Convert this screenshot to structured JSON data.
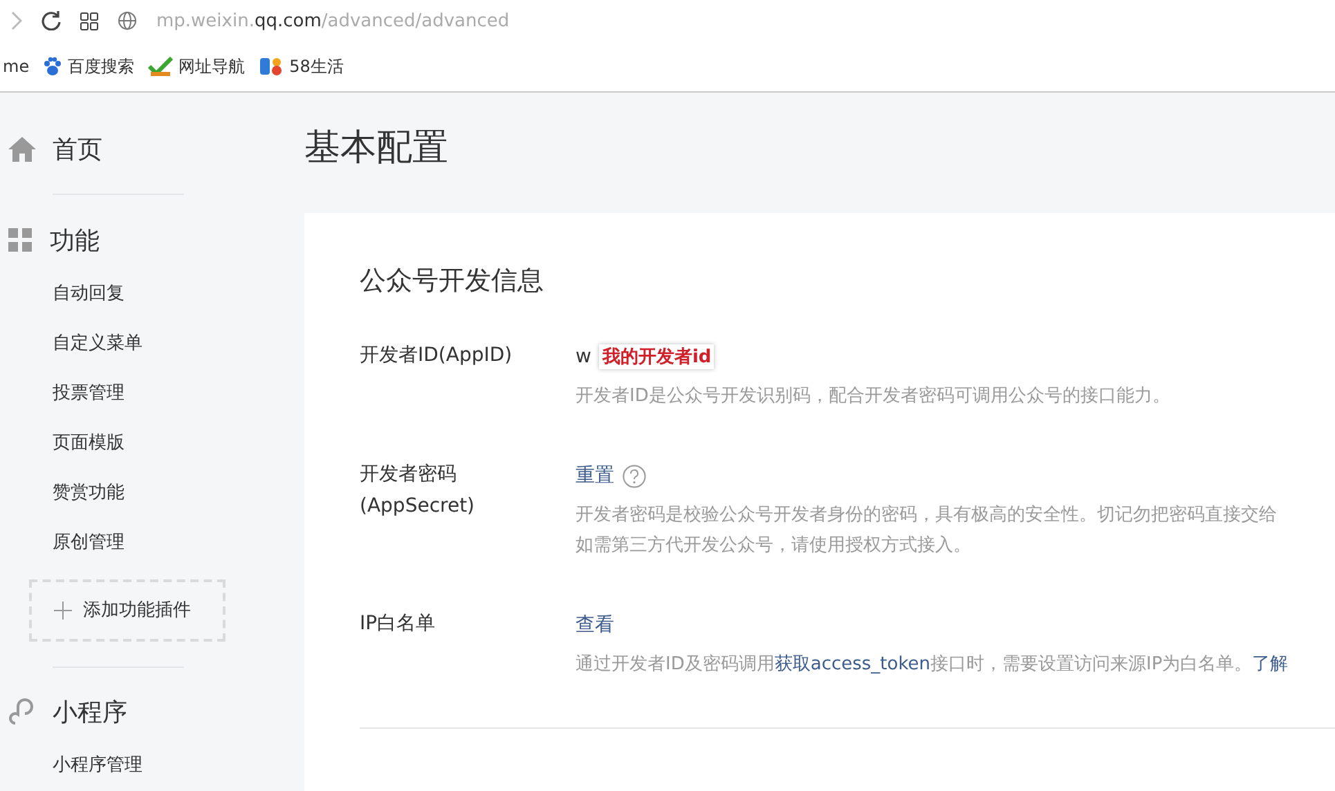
{
  "browser": {
    "url_host": "mp.weixin.",
    "url_domain": "qq.com",
    "url_path": "/advanced/advanced"
  },
  "bookmarks": [
    {
      "label": "me",
      "kind": "none"
    },
    {
      "label": "百度搜索",
      "kind": "paw"
    },
    {
      "label": "网址导航",
      "kind": "check"
    },
    {
      "label": "58生活",
      "kind": "fifty"
    }
  ],
  "sidebar": {
    "sections": [
      {
        "title": "首页",
        "kind": "home"
      },
      {
        "title": "功能",
        "kind": "grid",
        "items": [
          "自动回复",
          "自定义菜单",
          "投票管理",
          "页面模版",
          "赞赏功能",
          "原创管理"
        ],
        "add_button": "添加功能插件"
      },
      {
        "title": "小程序",
        "kind": "link",
        "items": [
          "小程序管理"
        ]
      }
    ]
  },
  "page_title": "基本配置",
  "card": {
    "title": "公众号开发信息",
    "rows": [
      {
        "label": "开发者ID(AppID)",
        "value": "w",
        "annotation": "我的开发者id",
        "desc": [
          "开发者ID是公众号开发识别码，配合开发者密码可调用公众号的接口能力。"
        ]
      },
      {
        "label": "开发者密码",
        "label2": "(AppSecret)",
        "action": "重置",
        "help": true,
        "desc": [
          "开发者密码是校验公众号开发者身份的密码，具有极高的安全性。切记勿把密码直接交给",
          "如需第三方代开发公众号，请使用授权方式接入。"
        ]
      },
      {
        "label": "IP白名单",
        "action": "查看",
        "desc_before": "通过开发者ID及密码调用",
        "desc_link": "获取access_token",
        "desc_after": "接口时，需要设置访问来源IP为白名单。",
        "desc_more": "了解"
      }
    ]
  }
}
